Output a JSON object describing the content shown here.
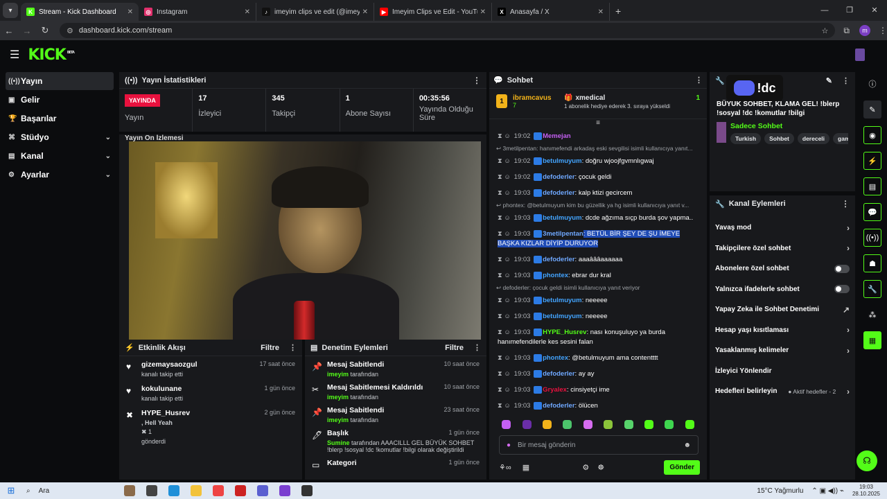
{
  "browser": {
    "tabs": [
      {
        "title": "Stream - Kick Dashboard",
        "fav": "K",
        "favcolor": "#53fc18"
      },
      {
        "title": "Instagram",
        "fav": "◎",
        "favcolor": "#e1306c"
      },
      {
        "title": "imeyim clips ve edit (@imeyim",
        "fav": "♪",
        "favcolor": "#111111"
      },
      {
        "title": "İmeyim Clips ve Edit - YouTube",
        "fav": "▶",
        "favcolor": "#ff0000"
      },
      {
        "title": "Anasayfa / X",
        "fav": "X",
        "favcolor": "#000000"
      }
    ],
    "url": "dashboard.kick.com/stream",
    "profile_initial": "m"
  },
  "logo": "KICK",
  "logo_badge": "BETA",
  "sidebar": [
    {
      "label": "Yayın",
      "icon": "((•))"
    },
    {
      "label": "Gelir",
      "icon": "▣"
    },
    {
      "label": "Başarılar",
      "icon": "🏆"
    },
    {
      "label": "Stüdyo",
      "icon": "⌘"
    },
    {
      "label": "Kanal",
      "icon": "▤"
    },
    {
      "label": "Ayarlar",
      "icon": "⚙"
    }
  ],
  "stats": {
    "title": "Yayın İstatistikleri",
    "live_badge": "YAYINDA",
    "live_label": "Yayın",
    "items": [
      {
        "value": "17",
        "label": "İzleyici"
      },
      {
        "value": "345",
        "label": "Takipçi"
      },
      {
        "value": "1",
        "label": "Abone Sayısı"
      },
      {
        "value": "00:35:56",
        "label": "Yayında Olduğu Süre"
      }
    ]
  },
  "preview": {
    "title": "Yayın Ön İzlemesi"
  },
  "activity": {
    "title": "Etkinlik Akışı",
    "filter": "Filtre",
    "items": [
      {
        "name": "gizemaysaozgul",
        "sub": "kanalı takip etti",
        "time": "17 saat önce",
        "icon": "♥"
      },
      {
        "name": "kokulunane",
        "sub": "kanalı takip etti",
        "time": "1 gün önce",
        "icon": "♥"
      },
      {
        "name": "HYPE_Husrev",
        "sub": ", Hell Yeah",
        "sub2": "1",
        "sub3": "gönderdi",
        "time": "2 gün önce",
        "icon": "✖"
      }
    ]
  },
  "moderation": {
    "title": "Denetim Eylemleri",
    "filter": "Filtre",
    "items": [
      {
        "name": "Mesaj Sabitlendi",
        "by": "imeyim",
        "tail": "tarafından",
        "time": "10 saat önce",
        "icon": "📌"
      },
      {
        "name": "Mesaj Sabitlemesi Kaldırıldı",
        "by": "imeyim",
        "tail": "tarafından",
        "time": "10 saat önce",
        "icon": "✂"
      },
      {
        "name": "Mesaj Sabitlendi",
        "by": "imeyim",
        "tail": "tarafından",
        "time": "23 saat önce",
        "icon": "📌"
      },
      {
        "name": "Başlık",
        "by": "Sumine",
        "tail": "tarafından AAACILLL GEL BÜYÜK SOHBET !blerp !sosyal !dc !komutlar !bilgi olarak değiştirildi",
        "time": "1 gün önce",
        "icon": "🖊"
      },
      {
        "name": "Kategori",
        "by": "",
        "tail": "",
        "time": "1 gün önce",
        "icon": "▭"
      }
    ]
  },
  "chat": {
    "title": "Sohbet",
    "pinned": {
      "user": "ibramcavus",
      "count": "7",
      "gifter": "xmedical",
      "gift_count": "1",
      "note": "1 abonelik hediye ederek 3. sıraya yükseldi"
    },
    "messages": [
      {
        "time": "19:02",
        "user": "Memejan",
        "color": "#c45ff2",
        "text": ""
      },
      {
        "reply": "3metilpentan: hanımefendi arkadaş eski sevgilisi isimli kullanıcıya yanıt..."
      },
      {
        "time": "19:02",
        "user": "betulmuyum",
        "color": "#43a4ff",
        "text": ": doğru wjoojfgvmnlıgwaj"
      },
      {
        "time": "19:02",
        "user": "defoderler",
        "color": "#6fa8ff",
        "text": ": çocuk geldi"
      },
      {
        "time": "19:03",
        "user": "defoderler",
        "color": "#6fa8ff",
        "text": ": kalp ktizi gecircem"
      },
      {
        "reply": "phontex: @betulmuyum kim bu güzellik ya hg isimli kullanıcıya yanıt v..."
      },
      {
        "time": "19:03",
        "user": "betulmuyum",
        "color": "#43a4ff",
        "text": ": dcde ağzıma sıçp burda şov yapma.."
      },
      {
        "time": "19:03",
        "user": "3metilpentan",
        "color": "#6fa8ff",
        "text": ": BETÜL BİR ŞEY DE ŞU İMEYE BAŞKA KIZLAR DİYİP DURUYOR",
        "hl": true
      },
      {
        "time": "19:03",
        "user": "defoderler",
        "color": "#6fa8ff",
        "text": ": aaaâââaaaaaa"
      },
      {
        "time": "19:03",
        "user": "phontex",
        "color": "#43a4ff",
        "text": ": ebrar dur kral"
      },
      {
        "reply": "defoderler: çocuk geldi isimli kullanıcıya yanıt veriyor"
      },
      {
        "time": "19:03",
        "user": "betulmuyum",
        "color": "#43a4ff",
        "text": ": neeeee"
      },
      {
        "time": "19:03",
        "user": "betulmuyum",
        "color": "#43a4ff",
        "text": ": neeeee"
      },
      {
        "time": "19:03",
        "user": "HYPE_Husrev",
        "color": "#53fc18",
        "text": ": nası konuşuluyo ya burda hanımefendilerle kes sesini falan"
      },
      {
        "time": "19:03",
        "user": "phontex",
        "color": "#43a4ff",
        "text": ": @betulmuyum ama contentttt"
      },
      {
        "time": "19:03",
        "user": "defoderler",
        "color": "#6fa8ff",
        "text": ": ay ay"
      },
      {
        "time": "19:03",
        "user": "Gryalex",
        "color": "#e8113e",
        "text": ": cinsiyetçi ime"
      },
      {
        "time": "19:03",
        "user": "defoderler",
        "color": "#6fa8ff",
        "text": ": ölücen"
      }
    ],
    "input_placeholder": "Bir mesaj gönderin",
    "send": "Gönder"
  },
  "stream_info": {
    "discord": "!dc",
    "title": "BÜYÜK SOHBET, KLAMA GEL! !blerp !sosyal !dc !komutlar !bilgi",
    "category": "Sadece Sohbet",
    "tags": [
      "Turkish",
      "Sohbet",
      "dereceli",
      "gaming"
    ]
  },
  "channel_actions": {
    "title": "Kanal Eylemleri",
    "items": [
      {
        "label": "Yavaş mod",
        "kind": "chev"
      },
      {
        "label": "Takipçilere özel sohbet",
        "kind": "chev"
      },
      {
        "label": "Abonelere özel sohbet",
        "kind": "toggle"
      },
      {
        "label": "Yalnızca ifadelerle sohbet",
        "kind": "toggle"
      },
      {
        "label": "Yapay Zeka ile Sohbet Denetimi",
        "kind": "ext"
      },
      {
        "label": "Hesap yaşı kısıtlaması",
        "kind": "chev"
      },
      {
        "label": "Yasaklanmış kelimeler",
        "kind": "chev"
      },
      {
        "label": "İzleyici Yönlendir",
        "kind": "none"
      },
      {
        "label": "Hedefleri belirleyin",
        "kind": "goal",
        "extra": "Aktif hedefler - 2"
      }
    ]
  },
  "taskbar": {
    "search": "Ara",
    "weather": "15°C  Yağmurlu",
    "time": "19:03",
    "date": "28.10.2025"
  }
}
